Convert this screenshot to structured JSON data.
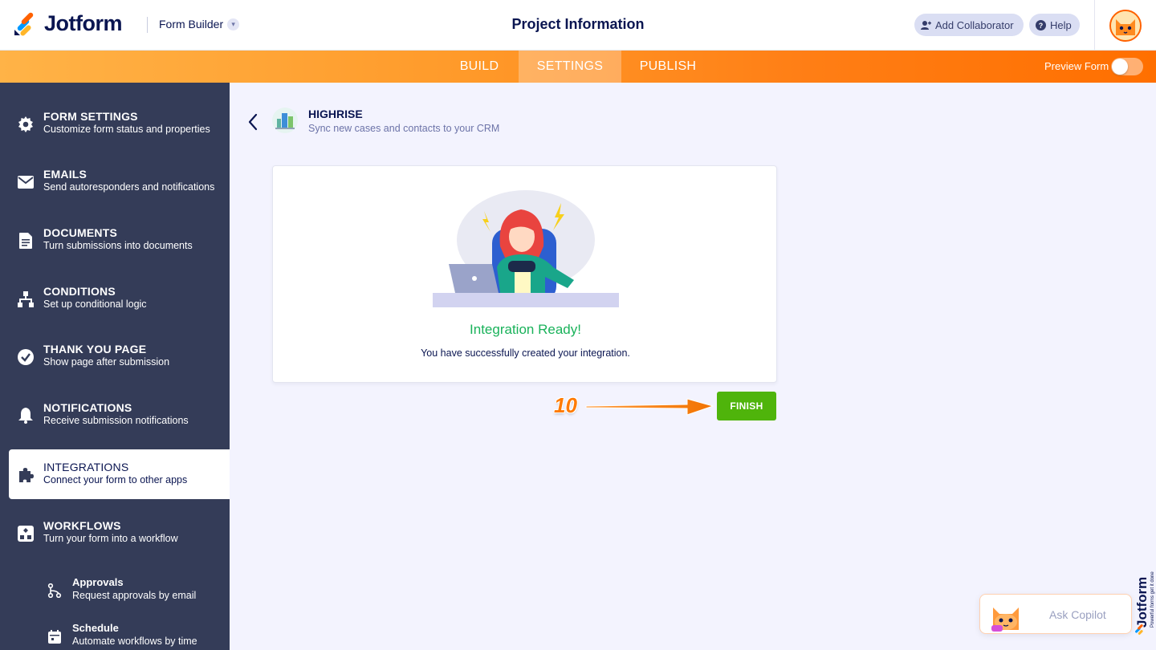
{
  "header": {
    "logo_text": "Jotform",
    "builder_label": "Form Builder",
    "page_title": "Project Information",
    "add_collaborator_label": "Add Collaborator",
    "help_label": "Help"
  },
  "nav": {
    "tabs": [
      {
        "label": "BUILD",
        "active": false
      },
      {
        "label": "SETTINGS",
        "active": true
      },
      {
        "label": "PUBLISH",
        "active": false
      }
    ],
    "preview_label": "Preview Form",
    "preview_on": false
  },
  "sidebar": {
    "items": [
      {
        "title": "FORM SETTINGS",
        "desc": "Customize form status and properties",
        "icon": "gear-icon"
      },
      {
        "title": "EMAILS",
        "desc": "Send autoresponders and notifications",
        "icon": "envelope-icon"
      },
      {
        "title": "DOCUMENTS",
        "desc": "Turn submissions into documents",
        "icon": "document-icon"
      },
      {
        "title": "CONDITIONS",
        "desc": "Set up conditional logic",
        "icon": "hierarchy-icon"
      },
      {
        "title": "THANK YOU PAGE",
        "desc": "Show page after submission",
        "icon": "check-circle-icon"
      },
      {
        "title": "NOTIFICATIONS",
        "desc": "Receive submission notifications",
        "icon": "bell-icon"
      },
      {
        "title": "INTEGRATIONS",
        "desc": "Connect your form to other apps",
        "icon": "puzzle-icon",
        "active": true
      },
      {
        "title": "WORKFLOWS",
        "desc": "Turn your form into a workflow",
        "icon": "workflow-icon"
      }
    ],
    "subitems": [
      {
        "title": "Approvals",
        "desc": "Request approvals by email",
        "icon": "approval-flow-icon"
      },
      {
        "title": "Schedule",
        "desc": "Automate workflows by time",
        "icon": "calendar-icon"
      }
    ]
  },
  "integration": {
    "name": "HIGHRISE",
    "description": "Sync new cases and contacts to your CRM",
    "status_title": "Integration Ready!",
    "status_desc": "You have successfully created your integration.",
    "finish_label": "FINISH"
  },
  "annotation": {
    "step_number": "10"
  },
  "copilot": {
    "label": "Ask Copilot"
  },
  "colors": {
    "accent_orange": "#ff7e15",
    "sidebar_bg": "#343c58",
    "success_green": "#19b25a",
    "finish_green": "#4fb40b"
  }
}
